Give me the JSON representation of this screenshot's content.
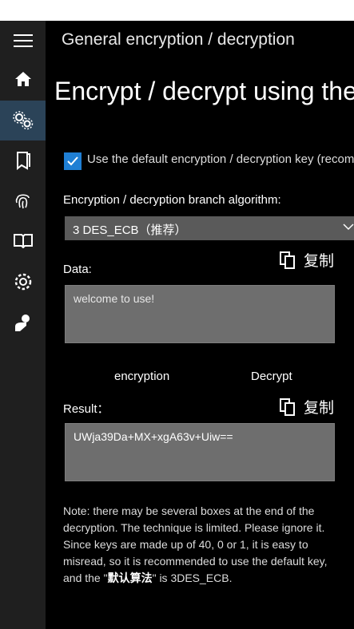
{
  "header": {
    "title": "General encryption / decryption"
  },
  "page": {
    "title": "Encrypt / decrypt using the"
  },
  "nav": {
    "items": [
      {
        "icon": "hamburger-menu-icon"
      },
      {
        "icon": "home-icon"
      },
      {
        "icon": "gears-icon",
        "active": true
      },
      {
        "icon": "book-icon"
      },
      {
        "icon": "fingerprint-icon"
      },
      {
        "icon": "open-book-icon"
      },
      {
        "icon": "settings-icon"
      },
      {
        "icon": "person-icon"
      }
    ]
  },
  "default_key": {
    "checked": true,
    "label": "Use the default encryption / decryption key (recom"
  },
  "algorithm": {
    "label": "Encryption / decryption branch algorithm:",
    "selected": "3 DES_ECB（推荐）"
  },
  "data_section": {
    "label": "Data:",
    "copy_label": "复制",
    "value": "welcome to use!"
  },
  "actions": {
    "encrypt": "encryption",
    "decrypt": "Decrypt"
  },
  "result_section": {
    "label": "Result：",
    "copy_label": "复制",
    "value": "UWja39Da+MX+xgA63v+Uiw=="
  },
  "note": {
    "part1": "Note: there may be several boxes at the end of the decryption. The technique is limited. Please ignore it. Since keys are made up of 40, 0 or 1, it is easy to misread, so it is recommended to use the default key, and the \"",
    "bold": "默认算法",
    "part2": "\" is 3DES_ECB."
  },
  "colors": {
    "accent": "#1f7fd4",
    "rail_active": "#2b4358",
    "input_bg": "#6e6e6e"
  }
}
